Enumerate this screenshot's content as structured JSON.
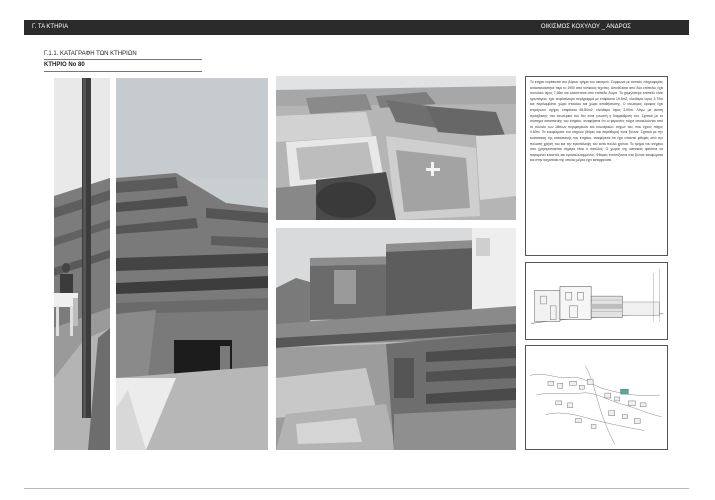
{
  "header": {
    "left_label": "Γ. ΤΑ ΚΤΗΡΙΑ",
    "right_label": "ΟΙΚΙΣΜΟΣ ΚΟΧΥΛΟΥ _ ΑΝΔΡΟΣ"
  },
  "section": {
    "title": "Γ.1.1. ΚΑΤΑΓΡΑΦΗ ΤΩΝ ΚΤΗΡΙΩΝ",
    "building_id": "ΚΤΗΡΙΟ Νο 80"
  },
  "description": {
    "text": "Το κτήριο ευρίσκεται στο βόρειο τμήμα του οικισμού. Σύμφωνα με τοπικές πληροφορίες κατασκευάστηκε περί το 1900 από τοπικούς τεχνίτες. Αποτελείται από δύο επίπεδα, έχει συνολικό ύψος 7,65m και καλύπτεται από επίπεδο δώμα. Το χαμηλότερο επίπεδο είναι ημιυπόγειο, έχει τετράπλευρο περίγραμμα με επιφάνεια 19,5m2, ελεύθερο ύψος 3,70m και περιλαμβάνει χώρο σταύλου και χώρο αποθήκευσης. Ο ανώτερος όροφος έχει τετράγωνο σχήμα, επιφάνεια 65,80m2, ελεύθερο ύψος 3,90m. Λόγω με άνεση πρόσβασης στο εσωτερικό του δεν είναι γνωστή η διαρρύθμιση του. Σχετικά με το σύστημα κατασκευής του κτηρίου, αναφέρεται ότι οι φέροντες τοίχοι αποτελούνται από το σύνολο των λίθινων περιμετρικών και εσωτερικών τοίχων του, που έχουν πάχος 0,60m. Τα κουφώματα του κτηρίου (θύρες και παράθυρα) είναι ξύλινα. Σχετικά με την κατάσταση της κατασκευής του κτηρίου, αναφέρεται ότι έχει υποστεί φθορές από την πολυετή χρήση του και την εγκατάλειψη του κατά πολλά χρόνια. Το τμήμα του κτηρίου που χρησιμοποιείται σήμερα είναι ο σταύλος. Ο χώρος της κατοικίας φαίνεται να παραμένει κλειστός και εγκαταλελειμμένος. Φθορές εντοπίζονται στα ξύλινα κουφώματα και στην τοιχοποιία της οποίας μέρος έχει καταρρεύσει."
  },
  "colors": {
    "header_bg": "#2b2b2b",
    "header_text": "#ffffff",
    "highlight_building": "#5aa89a"
  },
  "figures": {
    "photo_lane_icon": "photo-icon",
    "photo_stone_icon": "photo-icon",
    "photo_roofs_icon": "photo-icon",
    "photo_houses_icon": "photo-icon",
    "elevation_icon": "drawing-icon",
    "site_plan_icon": "map-icon"
  }
}
